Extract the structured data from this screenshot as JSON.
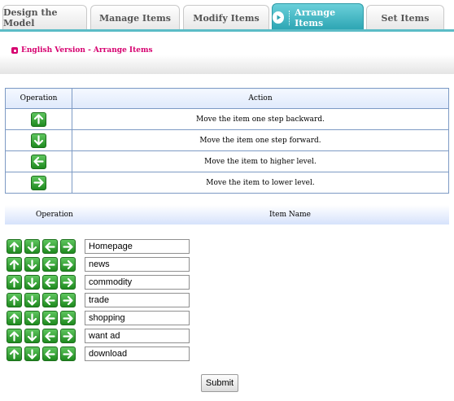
{
  "tabs": [
    {
      "label": "Design the Model",
      "active": false
    },
    {
      "label": "Manage Items",
      "active": false
    },
    {
      "label": "Modify Items",
      "active": false
    },
    {
      "label": "Arrange Items",
      "active": true
    },
    {
      "label": "Set Items",
      "active": false
    }
  ],
  "breadcrumb": "English Version - Arrange Items",
  "legend": {
    "col_operation": "Operation",
    "col_action": "Action",
    "rows": [
      {
        "icon": "arrow-up-icon",
        "action": "Move the item one step backward."
      },
      {
        "icon": "arrow-down-icon",
        "action": "Move the item one step forward."
      },
      {
        "icon": "arrow-left-icon",
        "action": "Move the item to higher level."
      },
      {
        "icon": "arrow-right-icon",
        "action": "Move the item to lower level."
      }
    ]
  },
  "items_header": {
    "operation": "Operation",
    "item_name": "Item Name"
  },
  "items": [
    {
      "name": "Homepage"
    },
    {
      "name": "news"
    },
    {
      "name": "commodity"
    },
    {
      "name": "trade"
    },
    {
      "name": "shopping"
    },
    {
      "name": "want ad"
    },
    {
      "name": "download"
    }
  ],
  "submit_label": "Submit",
  "colors": {
    "accent_teal": "#2aa3b1",
    "breadcrumb_pink": "#d6006f",
    "arrow_green": "#1f8a1f",
    "table_border": "#7d9ac4"
  }
}
